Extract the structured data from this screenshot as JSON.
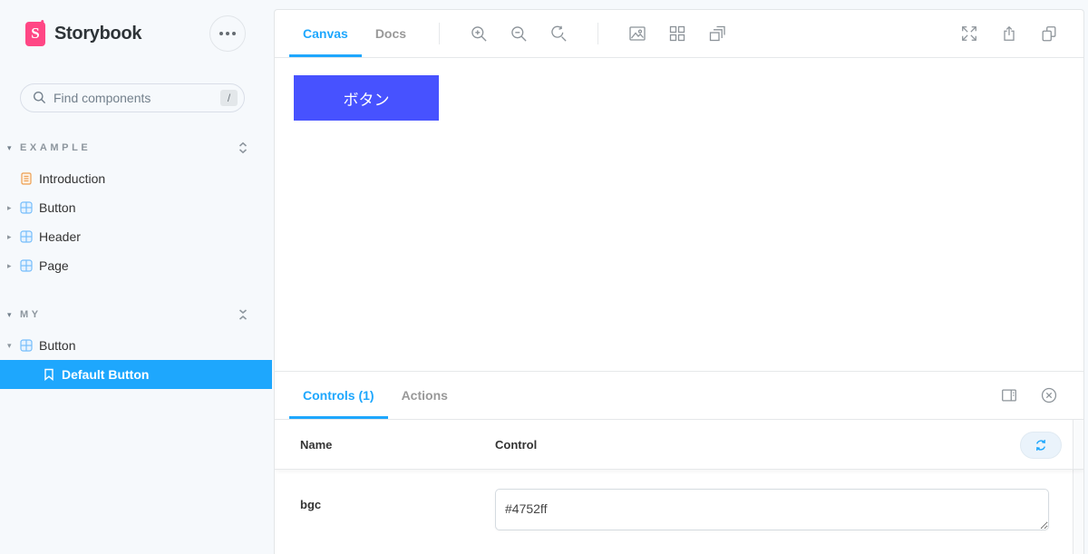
{
  "app": {
    "name": "Storybook"
  },
  "colors": {
    "accent": "#1EA7FD",
    "brand": "#FF4785",
    "component_icon": "#77BEFB",
    "doc_icon": "#ED9E50",
    "canvas_button_bg": "#4752ff"
  },
  "sidebar": {
    "logo_letter": "S",
    "search": {
      "placeholder": "Find components",
      "shortcut": "/"
    },
    "sections": [
      {
        "label": "EXAMPLE",
        "tool_icon": "expand-all-icon",
        "items": [
          {
            "label": "Introduction",
            "icon": "document"
          },
          {
            "label": "Button",
            "icon": "component"
          },
          {
            "label": "Header",
            "icon": "component"
          },
          {
            "label": "Page",
            "icon": "component"
          }
        ]
      },
      {
        "label": "MY",
        "tool_icon": "collapse-all-icon",
        "items": [
          {
            "label": "Button",
            "icon": "component",
            "expanded": true,
            "children": [
              {
                "label": "Default Button",
                "icon": "bookmark",
                "selected": true
              }
            ]
          }
        ]
      }
    ]
  },
  "preview": {
    "tabs": {
      "canvas": "Canvas",
      "docs": "Docs"
    },
    "active_tab": "Canvas",
    "toolbar_icons": [
      "zoom-in",
      "zoom-out",
      "zoom-reset",
      "change-background",
      "grid",
      "grow-viewport"
    ],
    "window_icons": [
      "fullscreen",
      "share",
      "open-in-new-tab"
    ],
    "story": {
      "button_label": "ボタン",
      "button_bg": "#4752ff"
    }
  },
  "addons": {
    "tabs": {
      "controls": "Controls (1)",
      "actions": "Actions"
    },
    "active_tab": "Controls (1)",
    "panel_icons": [
      "change-orientation",
      "close-panel"
    ],
    "controls_table": {
      "columns": {
        "name": "Name",
        "control": "Control"
      },
      "reset_icon": "sync",
      "rows": [
        {
          "name": "bgc",
          "value": "#4752ff"
        }
      ]
    }
  }
}
